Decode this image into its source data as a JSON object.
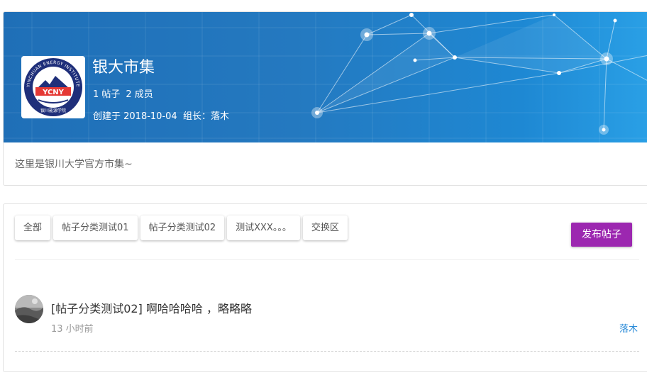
{
  "group": {
    "name": "银大市集",
    "posts_label": "1 帖子",
    "members_label": "2 成员",
    "created_label": "创建于 2018-10-04",
    "leader_label": "组长：落木",
    "description": "这里是银川大学官方市集~",
    "logo_text": "YCNY",
    "logo_ring_text": "YINCHUAN ENERGY INSTITUTE",
    "logo_bottom_text": "银川能源学院"
  },
  "tabs": [
    "全部",
    "帖子分类测试01",
    "帖子分类测试02",
    "测试XXX。。。",
    "交换区"
  ],
  "publish_label": "发布帖子",
  "posts": [
    {
      "title": "[帖子分类测试02] 啊哈哈哈哈 ，略略略",
      "time": "13 小时前",
      "author": "落木"
    }
  ],
  "colors": {
    "banner": "#2479c0",
    "publish_button": "#9c27b0",
    "author_link": "#2a8bd8"
  }
}
